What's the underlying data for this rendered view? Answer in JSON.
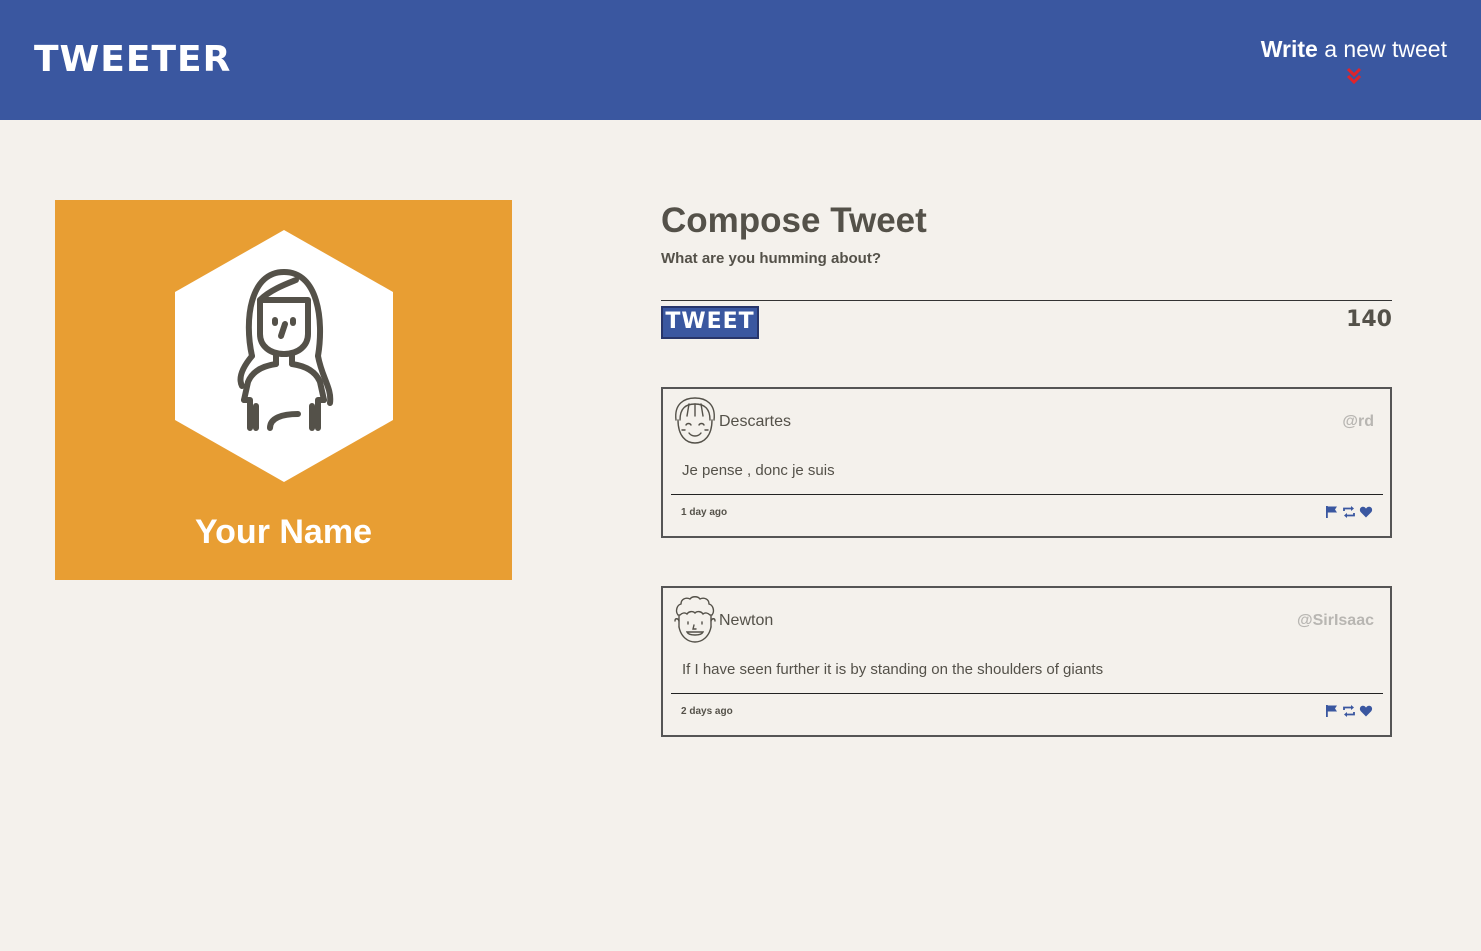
{
  "header": {
    "brand": "TWEETER",
    "write_strong": "Write",
    "write_rest": " a new tweet",
    "chevron_icon": "double-chevron-down-icon",
    "chevron_color": "#e0242b",
    "background": "#3a57a0"
  },
  "profile": {
    "name": "Your Name",
    "avatar_icon": "female-user-avatar-icon",
    "background": "#e89e33"
  },
  "compose": {
    "title": "Compose Tweet",
    "subtitle": "What are you humming about?",
    "button_label": "TWEET",
    "counter": "140"
  },
  "tweets": [
    {
      "name": "Descartes",
      "handle": "@rd",
      "text": "Je pense , donc je suis",
      "age": "1 day ago",
      "avatar_icon": "smiling-face-avatar-icon"
    },
    {
      "name": "Newton",
      "handle": "@SirIsaac",
      "text": "If I have seen further it is by standing on the shoulders of giants",
      "age": "2 days ago",
      "avatar_icon": "curly-hair-face-avatar-icon"
    }
  ],
  "action_icons": [
    "flag-icon",
    "retweet-icon",
    "heart-icon"
  ],
  "colors": {
    "accent": "#3a57a0",
    "card": "#e89e33",
    "text": "#545149",
    "muted": "#b8b6b2"
  }
}
